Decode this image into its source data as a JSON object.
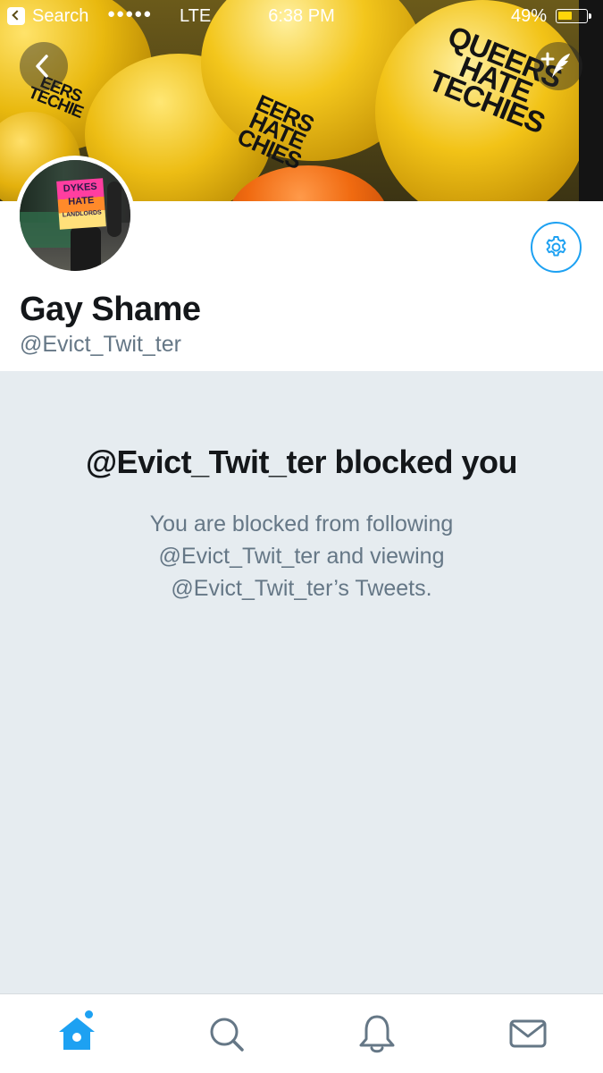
{
  "status_bar": {
    "back_app_label": "Search",
    "signal_dots": "●●●●●",
    "carrier": "LTE",
    "time": "6:38 PM",
    "battery_percent": "49%",
    "battery_level": 0.49
  },
  "header": {
    "banner_texts": [
      "QUEERS HATE TECHIES",
      "EERS HATE CHIES",
      "EERS TECHIE"
    ],
    "icons": {
      "back": "chevron-left-icon",
      "compose": "compose-tweet-icon"
    }
  },
  "profile": {
    "avatar_sign_text": [
      "DYKES",
      "HATE",
      "LANDLORDS"
    ],
    "display_name": "Gay Shame",
    "handle": "@Evict_Twit_ter",
    "settings_icon": "gear-icon"
  },
  "blocked": {
    "title": "@Evict_Twit_ter blocked you",
    "message": "You are blocked from following @Evict_Twit_ter and viewing @Evict_Twit_ter’s Tweets."
  },
  "tab_bar": {
    "tabs": [
      {
        "name": "home",
        "icon": "home-icon",
        "active": true
      },
      {
        "name": "search",
        "icon": "search-icon",
        "active": false
      },
      {
        "name": "notifications",
        "icon": "bell-icon",
        "active": false
      },
      {
        "name": "messages",
        "icon": "envelope-icon",
        "active": false
      }
    ]
  },
  "colors": {
    "accent": "#1da1f2",
    "text_primary": "#14171a",
    "text_secondary": "#657786",
    "background": "#e6ecf0",
    "icon_inactive": "#657786"
  }
}
